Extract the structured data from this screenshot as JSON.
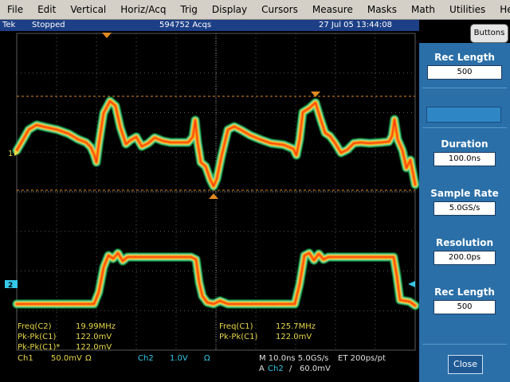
{
  "menu": [
    "File",
    "Edit",
    "Vertical",
    "Horiz/Acq",
    "Trig",
    "Display",
    "Cursors",
    "Measure",
    "Masks",
    "Math",
    "Utilities",
    "Help"
  ],
  "status": {
    "brand": "Tek",
    "state": "Stopped",
    "acqs": "594752 Acqs",
    "datetime": "27 Jul 05 13:44:08"
  },
  "buttons_label": "Buttons",
  "panel": {
    "rec_length_top": {
      "label": "Rec Length",
      "value": "500"
    },
    "duration": {
      "label": "Duration",
      "value": "100.0ns"
    },
    "sample_rate": {
      "label": "Sample Rate",
      "value": "5.0GS/s"
    },
    "resolution": {
      "label": "Resolution",
      "value": "200.0ps"
    },
    "rec_length_bottom": {
      "label": "Rec Length",
      "value": "500"
    },
    "close_label": "Close"
  },
  "markers": {
    "ch1": "1",
    "ch2": "2"
  },
  "measurements": {
    "left": [
      {
        "name": "Freq(C2)",
        "value": "19.99MHz"
      },
      {
        "name": "Pk-Pk(C1)",
        "value": "122.0mV"
      },
      {
        "name": "Pk-Pk(C1)*",
        "value": "122.0mV"
      }
    ],
    "right": [
      {
        "name": "Freq(C1)",
        "value": "125.7MHz"
      },
      {
        "name": "Pk-Pk(C1)",
        "value": "122.0mV"
      }
    ]
  },
  "channels": {
    "ch1": {
      "name": "Ch1",
      "scale": "50.0mV",
      "ohm": "Ω"
    },
    "ch2": {
      "name": "Ch2",
      "scale": "1.0V",
      "ohm": "Ω"
    },
    "timebase": "M 10.0ns 5.0GS/s",
    "et": "ET 200ps/pt",
    "trigger": {
      "prefix": "A",
      "source": "Ch2",
      "slope": "/",
      "level": "60.0mV"
    }
  },
  "colors": {
    "ch1_trace": "#ff3b10",
    "ch2_trace": "#ff3b10",
    "halo_outer": "#1faa3a",
    "halo_mid": "#e8d020",
    "grid": "#5a5a5a",
    "cursor": "#e08a20"
  }
}
